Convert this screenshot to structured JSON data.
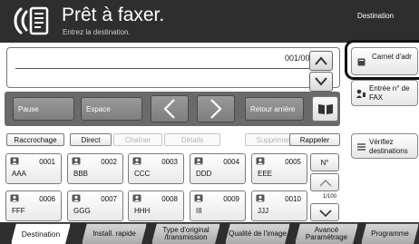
{
  "header": {
    "title": "Prêt à faxer.",
    "subtitle": "Entrez la destination.",
    "destination_label": "Destination"
  },
  "destination": {
    "counter": "001/001"
  },
  "keyboard": {
    "pause": "Pause",
    "space": "Espace",
    "backspace": "Retour arrière"
  },
  "side": {
    "address_book": "Carnet d'adr",
    "fax_entry": "Entrée n° de FAX",
    "check_destinations": "Vérifiez destinations"
  },
  "tabs": {
    "shortcut": "Raccrochage",
    "direct": "Direct",
    "chain": "Chaîner",
    "details": "Détails",
    "delete": "Supprimer",
    "recall": "Rappeler"
  },
  "speed_dials": [
    {
      "number": "0001",
      "name": "AAA"
    },
    {
      "number": "0002",
      "name": "BBB"
    },
    {
      "number": "0003",
      "name": "CCC"
    },
    {
      "number": "0004",
      "name": "DDD"
    },
    {
      "number": "0005",
      "name": "EEE"
    },
    {
      "number": "0006",
      "name": "FFF"
    },
    {
      "number": "0007",
      "name": "GGG"
    },
    {
      "number": "0008",
      "name": "HHH"
    },
    {
      "number": "0009",
      "name": "III"
    },
    {
      "number": "0010",
      "name": "JJJ"
    }
  ],
  "nav": {
    "number_button": "N°",
    "page": "1/100"
  },
  "bottom_tabs": {
    "destination": "Destination",
    "quick_setup": "Install. rapide",
    "original_type": "Type d'original /transmission",
    "image_quality": "Qualité de l'image",
    "advanced": "Avancé Paramétrage",
    "program": "Programme"
  }
}
